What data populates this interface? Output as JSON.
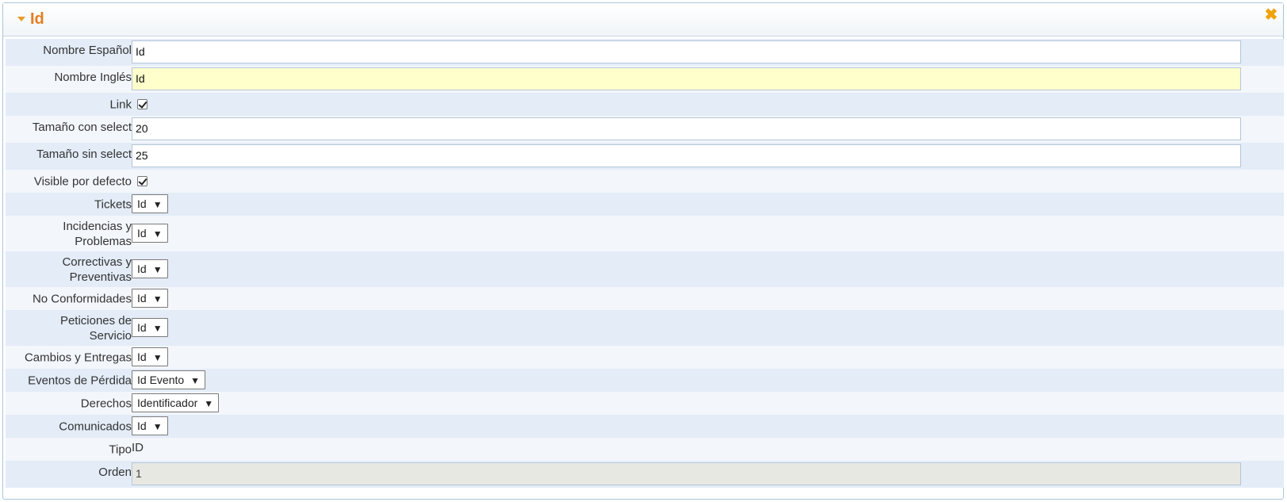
{
  "panel": {
    "title": "Id"
  },
  "rows": {
    "nombre_espanol": {
      "label": "Nombre Español",
      "value": "Id"
    },
    "nombre_ingles": {
      "label": "Nombre Inglés",
      "value": "Id"
    },
    "link": {
      "label": "Link",
      "checked": true
    },
    "tamano_con": {
      "label": "Tamaño con select",
      "value": "20"
    },
    "tamano_sin": {
      "label": "Tamaño sin select",
      "value": "25"
    },
    "visible": {
      "label": "Visible por defecto",
      "checked": true
    },
    "tickets": {
      "label": "Tickets",
      "value": "Id"
    },
    "incidencias": {
      "label1": "Incidencias y",
      "label2": "Problemas",
      "value": "Id"
    },
    "correctivas": {
      "label1": "Correctivas y",
      "label2": "Preventivas",
      "value": "Id"
    },
    "no_conf": {
      "label": "No Conformidades",
      "value": "Id"
    },
    "peticiones": {
      "label1": "Peticiones de",
      "label2": "Servicio",
      "value": "Id"
    },
    "cambios": {
      "label": "Cambios y Entregas",
      "value": "Id"
    },
    "eventos": {
      "label": "Eventos de Pérdida",
      "value": "Id Evento"
    },
    "derechos": {
      "label": "Derechos",
      "value": "Identificador"
    },
    "comunicados": {
      "label": "Comunicados",
      "value": "Id"
    },
    "tipo": {
      "label": "Tipo",
      "value": "ID"
    },
    "orden": {
      "label": "Orden",
      "value": "1"
    }
  },
  "icons": {
    "collapse": "triangle-down-icon",
    "close": "close-icon"
  },
  "colors": {
    "accent": "#e67e22",
    "row_alt": "#e3ecf7",
    "highlight": "#ffffcc"
  }
}
